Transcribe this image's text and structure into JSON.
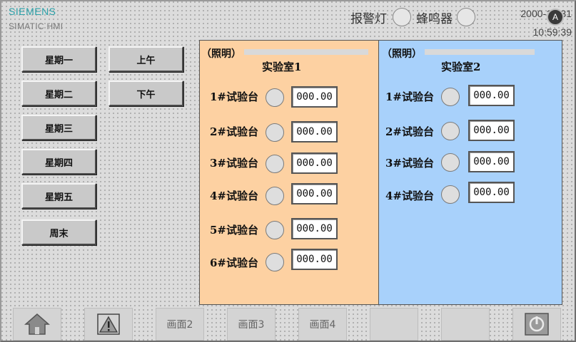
{
  "brand": {
    "name": "SIEMENS",
    "product": "SIMATIC HMI"
  },
  "header": {
    "alarm_label": "报警灯",
    "buzzer_label": "蜂鸣器",
    "date": "2000-12-31",
    "time": "10:59:39",
    "a_icon": "A"
  },
  "days": [
    "星期一",
    "星期二",
    "星期三",
    "星期四",
    "星期五",
    "周末"
  ],
  "periods": [
    "上午",
    "下午"
  ],
  "lab1": {
    "tag": "（照明）",
    "title": "实验室1",
    "rows": [
      {
        "label": "1#试验台",
        "value": "000.00"
      },
      {
        "label": "2#试验台",
        "value": "000.00"
      },
      {
        "label": "3#试验台",
        "value": "000.00"
      },
      {
        "label": "4#试验台",
        "value": "000.00"
      },
      {
        "label": "5#试验台",
        "value": "000.00"
      },
      {
        "label": "6#试验台",
        "value": "000.00"
      }
    ]
  },
  "lab2": {
    "tag": "（照明）",
    "title": "实验室2",
    "rows": [
      {
        "label": "1#试验台",
        "value": "000.00"
      },
      {
        "label": "2#试验台",
        "value": "000.00"
      },
      {
        "label": "3#试验台",
        "value": "000.00"
      },
      {
        "label": "4#试验台",
        "value": "000.00"
      }
    ]
  },
  "nav": {
    "screen2": "画面2",
    "screen3": "画面3",
    "screen4": "画面4"
  },
  "colors": {
    "lab1_bg": "#fdd1a2",
    "lab2_bg": "#a8d1fb",
    "brand": "#2aa0a8"
  }
}
